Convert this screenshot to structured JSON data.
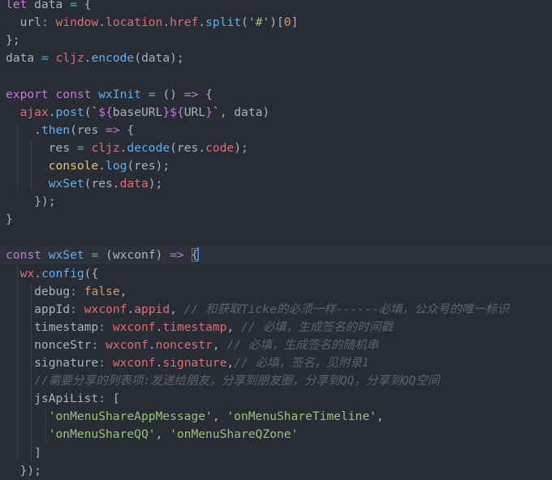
{
  "theme": {
    "background": "#282c34",
    "current_line": "#2c313c",
    "keyword": "#c678dd",
    "variable": "#e06c75",
    "function": "#61afef",
    "string": "#98c379",
    "number": "#d19a66",
    "operator": "#56b6c2",
    "builtin": "#e5c07b",
    "comment": "#5c6370",
    "text": "#abb2bf"
  },
  "code": {
    "lines": [
      [
        [
          "keyword",
          "let"
        ],
        [
          "plain",
          " data "
        ],
        [
          "op",
          "="
        ],
        [
          "plain",
          " {"
        ]
      ],
      [
        [
          "plain",
          "  url"
        ],
        [
          "op",
          ":"
        ],
        [
          "plain",
          " "
        ],
        [
          "var",
          "window"
        ],
        [
          "plain",
          "."
        ],
        [
          "var",
          "location"
        ],
        [
          "plain",
          "."
        ],
        [
          "var",
          "href"
        ],
        [
          "plain",
          "."
        ],
        [
          "func",
          "split"
        ],
        [
          "plain",
          "("
        ],
        [
          "string",
          "'#'"
        ],
        [
          "plain",
          ")["
        ],
        [
          "number",
          "0"
        ],
        [
          "plain",
          "]"
        ]
      ],
      [
        [
          "plain",
          "};"
        ]
      ],
      [
        [
          "plain",
          "data "
        ],
        [
          "op",
          "="
        ],
        [
          "plain",
          " "
        ],
        [
          "var",
          "cljz"
        ],
        [
          "plain",
          "."
        ],
        [
          "func",
          "encode"
        ],
        [
          "plain",
          "(data);"
        ]
      ],
      [
        [
          "plain",
          ""
        ]
      ],
      [
        [
          "keyword",
          "export"
        ],
        [
          "plain",
          " "
        ],
        [
          "keyword",
          "const"
        ],
        [
          "plain",
          " "
        ],
        [
          "func",
          "wxInit"
        ],
        [
          "plain",
          " "
        ],
        [
          "op",
          "="
        ],
        [
          "plain",
          " () "
        ],
        [
          "keyword",
          "=>"
        ],
        [
          "plain",
          " {"
        ]
      ],
      [
        [
          "plain",
          "  "
        ],
        [
          "var",
          "ajax"
        ],
        [
          "plain",
          "."
        ],
        [
          "func",
          "post"
        ],
        [
          "plain",
          "("
        ],
        [
          "string",
          "`"
        ],
        [
          "keyword",
          "${"
        ],
        [
          "plain",
          "baseURL"
        ],
        [
          "keyword",
          "}${"
        ],
        [
          "plain",
          "URL"
        ],
        [
          "keyword",
          "}"
        ],
        [
          "string",
          "`"
        ],
        [
          "plain",
          ", data)"
        ]
      ],
      [
        [
          "plain",
          "    ."
        ],
        [
          "func",
          "then"
        ],
        [
          "plain",
          "(res "
        ],
        [
          "keyword",
          "=>"
        ],
        [
          "plain",
          " {"
        ]
      ],
      [
        [
          "plain",
          "      res "
        ],
        [
          "op",
          "="
        ],
        [
          "plain",
          " "
        ],
        [
          "var",
          "cljz"
        ],
        [
          "plain",
          "."
        ],
        [
          "func",
          "decode"
        ],
        [
          "plain",
          "(res."
        ],
        [
          "var",
          "code"
        ],
        [
          "plain",
          ");"
        ]
      ],
      [
        [
          "plain",
          "      "
        ],
        [
          "builtin",
          "console"
        ],
        [
          "plain",
          "."
        ],
        [
          "func",
          "log"
        ],
        [
          "plain",
          "(res);"
        ]
      ],
      [
        [
          "plain",
          "      "
        ],
        [
          "func",
          "wxSet"
        ],
        [
          "plain",
          "(res."
        ],
        [
          "var",
          "data"
        ],
        [
          "plain",
          ");"
        ]
      ],
      [
        [
          "plain",
          "    });"
        ]
      ],
      [
        [
          "plain",
          "}"
        ]
      ],
      [
        [
          "plain",
          ""
        ]
      ],
      [
        [
          "keyword",
          "const"
        ],
        [
          "plain",
          " "
        ],
        [
          "func",
          "wxSet"
        ],
        [
          "plain",
          " "
        ],
        [
          "op",
          "="
        ],
        [
          "plain",
          " (wxconf) "
        ],
        [
          "keyword",
          "=>"
        ],
        [
          "plain",
          " "
        ],
        [
          "bracket",
          "{"
        ]
      ],
      [
        [
          "plain",
          "  "
        ],
        [
          "var",
          "wx"
        ],
        [
          "plain",
          "."
        ],
        [
          "func",
          "config"
        ],
        [
          "plain",
          "({"
        ]
      ],
      [
        [
          "plain",
          "    debug"
        ],
        [
          "op",
          ":"
        ],
        [
          "plain",
          " "
        ],
        [
          "number",
          "false"
        ],
        [
          "plain",
          ","
        ]
      ],
      [
        [
          "plain",
          "    appId"
        ],
        [
          "op",
          ":"
        ],
        [
          "plain",
          " "
        ],
        [
          "var",
          "wxconf"
        ],
        [
          "plain",
          "."
        ],
        [
          "var",
          "appid"
        ],
        [
          "plain",
          ", "
        ],
        [
          "comment",
          "// 和获取Ticke的必须一样------必填，公众号的唯一标识"
        ]
      ],
      [
        [
          "plain",
          "    timestamp"
        ],
        [
          "op",
          ":"
        ],
        [
          "plain",
          " "
        ],
        [
          "var",
          "wxconf"
        ],
        [
          "plain",
          "."
        ],
        [
          "var",
          "timestamp"
        ],
        [
          "plain",
          ", "
        ],
        [
          "comment",
          "// 必填，生成签名的时间戳"
        ]
      ],
      [
        [
          "plain",
          "    nonceStr"
        ],
        [
          "op",
          ":"
        ],
        [
          "plain",
          " "
        ],
        [
          "var",
          "wxconf"
        ],
        [
          "plain",
          "."
        ],
        [
          "var",
          "noncestr"
        ],
        [
          "plain",
          ", "
        ],
        [
          "comment",
          "// 必填，生成签名的随机串"
        ]
      ],
      [
        [
          "plain",
          "    signature"
        ],
        [
          "op",
          ":"
        ],
        [
          "plain",
          " "
        ],
        [
          "var",
          "wxconf"
        ],
        [
          "plain",
          "."
        ],
        [
          "var",
          "signature"
        ],
        [
          "plain",
          ","
        ],
        [
          "comment",
          "// 必填，签名，见附录1"
        ]
      ],
      [
        [
          "comment",
          "    //需要分享的列表项:发送给朋友，分享到朋友圈，分享到QQ，分享到QQ空间"
        ]
      ],
      [
        [
          "plain",
          "    jsApiList"
        ],
        [
          "op",
          ":"
        ],
        [
          "plain",
          " ["
        ]
      ],
      [
        [
          "plain",
          "      "
        ],
        [
          "string",
          "'onMenuShareAppMessage'"
        ],
        [
          "plain",
          ", "
        ],
        [
          "string",
          "'onMenuShareTimeline'"
        ],
        [
          "plain",
          ","
        ]
      ],
      [
        [
          "plain",
          "      "
        ],
        [
          "string",
          "'onMenuShareQQ'"
        ],
        [
          "plain",
          ", "
        ],
        [
          "string",
          "'onMenuShareQZone'"
        ]
      ],
      [
        [
          "plain",
          "    ]"
        ]
      ],
      [
        [
          "plain",
          "  });"
        ]
      ]
    ]
  }
}
